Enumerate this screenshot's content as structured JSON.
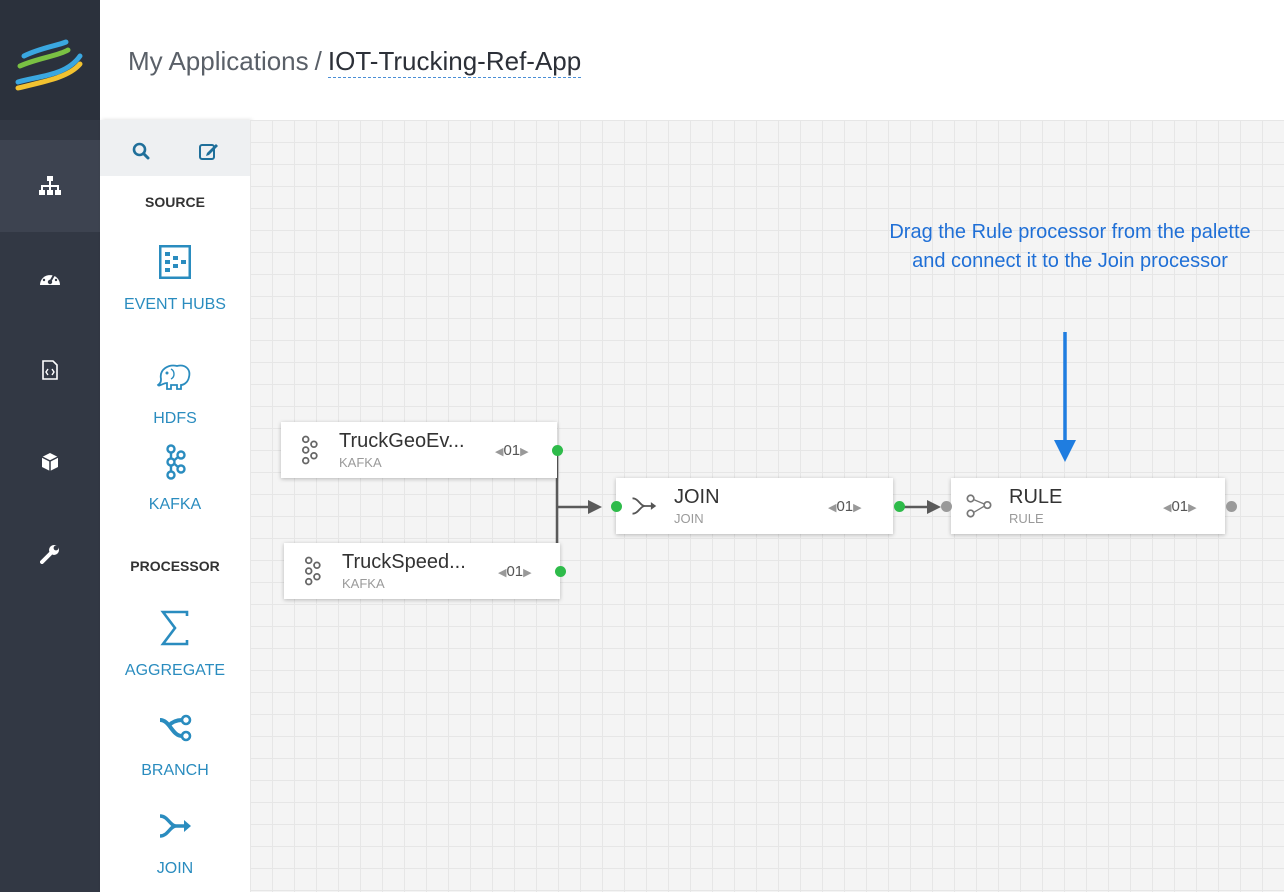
{
  "header": {
    "breadcrumb_root": "My Applications",
    "separator": "/",
    "app_name": "IOT-Trucking-Ref-App"
  },
  "nav": {
    "items": [
      {
        "icon": "topology-icon",
        "active": true
      },
      {
        "icon": "dashboard-icon",
        "active": false
      },
      {
        "icon": "code-file-icon",
        "active": false
      },
      {
        "icon": "cube-icon",
        "active": false
      },
      {
        "icon": "wrench-icon",
        "active": false
      }
    ]
  },
  "palette": {
    "tools": [
      "search-icon",
      "edit-icon"
    ],
    "source_heading": "SOURCE",
    "processor_heading": "PROCESSOR",
    "sources": [
      {
        "label": "EVENT HUBS",
        "icon": "event-hubs-icon"
      },
      {
        "label": "HDFS",
        "icon": "hdfs-elephant-icon"
      },
      {
        "label": "KAFKA",
        "icon": "kafka-icon"
      }
    ],
    "processors": [
      {
        "label": "AGGREGATE",
        "icon": "sigma-icon"
      },
      {
        "label": "BRANCH",
        "icon": "branch-icon"
      },
      {
        "label": "JOIN",
        "icon": "join-icon"
      }
    ]
  },
  "canvas": {
    "nodes": {
      "geo": {
        "title": "TruckGeoEv...",
        "type": "KAFKA",
        "parallelism": "01"
      },
      "speed": {
        "title": "TruckSpeed...",
        "type": "KAFKA",
        "parallelism": "01"
      },
      "join": {
        "title": "JOIN",
        "type": "JOIN",
        "parallelism": "01"
      },
      "rule": {
        "title": "RULE",
        "type": "RULE",
        "parallelism": "01"
      }
    },
    "hint": "Drag the Rule processor from the palette and connect it to the Join processor"
  },
  "colors": {
    "nav_bg": "#323844",
    "accent": "#2a8cbf",
    "port_green": "#2ebb4a",
    "hint_blue": "#1f6fd6"
  }
}
